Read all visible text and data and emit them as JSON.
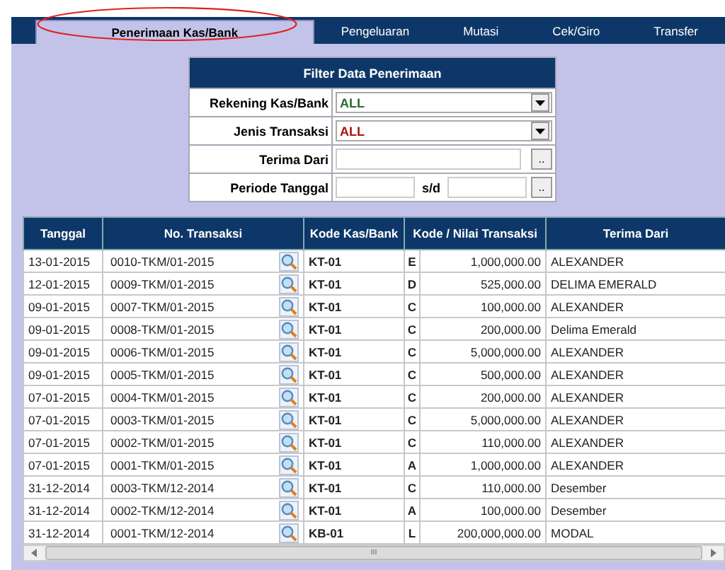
{
  "tabs": [
    {
      "label": "Penerimaan Kas/Bank",
      "selected": true
    },
    {
      "label": "Pengeluaran",
      "selected": false
    },
    {
      "label": "Mutasi",
      "selected": false
    },
    {
      "label": "Cek/Giro",
      "selected": false
    },
    {
      "label": "Transfer",
      "selected": false
    }
  ],
  "filter": {
    "title": "Filter Data Penerimaan",
    "rekening": {
      "label": "Rekening Kas/Bank",
      "value": "ALL"
    },
    "jenis": {
      "label": "Jenis Transaksi",
      "value": "ALL"
    },
    "terima": {
      "label": "Terima Dari",
      "button": ".."
    },
    "periode": {
      "label": "Periode Tanggal",
      "separator": "s/d",
      "button": ".."
    }
  },
  "table": {
    "columns": [
      "Tanggal",
      "No. Transaksi",
      "Kode Kas/Bank",
      "Kode / Nilai Transaksi",
      "Terima Dari"
    ],
    "rows": [
      {
        "tanggal": "13-01-2015",
        "no": "0010-TKM/01-2015",
        "kas": "KT-01",
        "kode": "E",
        "nilai": "1,000,000.00",
        "dari": "ALEXANDER"
      },
      {
        "tanggal": "12-01-2015",
        "no": "0009-TKM/01-2015",
        "kas": "KT-01",
        "kode": "D",
        "nilai": "525,000.00",
        "dari": "DELIMA EMERALD"
      },
      {
        "tanggal": "09-01-2015",
        "no": "0007-TKM/01-2015",
        "kas": "KT-01",
        "kode": "C",
        "nilai": "100,000.00",
        "dari": "ALEXANDER"
      },
      {
        "tanggal": "09-01-2015",
        "no": "0008-TKM/01-2015",
        "kas": "KT-01",
        "kode": "C",
        "nilai": "200,000.00",
        "dari": "Delima Emerald"
      },
      {
        "tanggal": "09-01-2015",
        "no": "0006-TKM/01-2015",
        "kas": "KT-01",
        "kode": "C",
        "nilai": "5,000,000.00",
        "dari": "ALEXANDER"
      },
      {
        "tanggal": "09-01-2015",
        "no": "0005-TKM/01-2015",
        "kas": "KT-01",
        "kode": "C",
        "nilai": "500,000.00",
        "dari": "ALEXANDER"
      },
      {
        "tanggal": "07-01-2015",
        "no": "0004-TKM/01-2015",
        "kas": "KT-01",
        "kode": "C",
        "nilai": "200,000.00",
        "dari": "ALEXANDER"
      },
      {
        "tanggal": "07-01-2015",
        "no": "0003-TKM/01-2015",
        "kas": "KT-01",
        "kode": "C",
        "nilai": "5,000,000.00",
        "dari": "ALEXANDER"
      },
      {
        "tanggal": "07-01-2015",
        "no": "0002-TKM/01-2015",
        "kas": "KT-01",
        "kode": "C",
        "nilai": "110,000.00",
        "dari": "ALEXANDER"
      },
      {
        "tanggal": "07-01-2015",
        "no": "0001-TKM/01-2015",
        "kas": "KT-01",
        "kode": "A",
        "nilai": "1,000,000.00",
        "dari": "ALEXANDER"
      },
      {
        "tanggal": "31-12-2014",
        "no": "0003-TKM/12-2014",
        "kas": "KT-01",
        "kode": "C",
        "nilai": "110,000.00",
        "dari": "Desember"
      },
      {
        "tanggal": "31-12-2014",
        "no": "0002-TKM/12-2014",
        "kas": "KT-01",
        "kode": "A",
        "nilai": "100,000.00",
        "dari": "Desember"
      },
      {
        "tanggal": "31-12-2014",
        "no": "0001-TKM/12-2014",
        "kas": "KB-01",
        "kode": "L",
        "nilai": "200,000,000.00",
        "dari": "MODAL"
      }
    ]
  },
  "scrollbar": {
    "grip": "III"
  }
}
